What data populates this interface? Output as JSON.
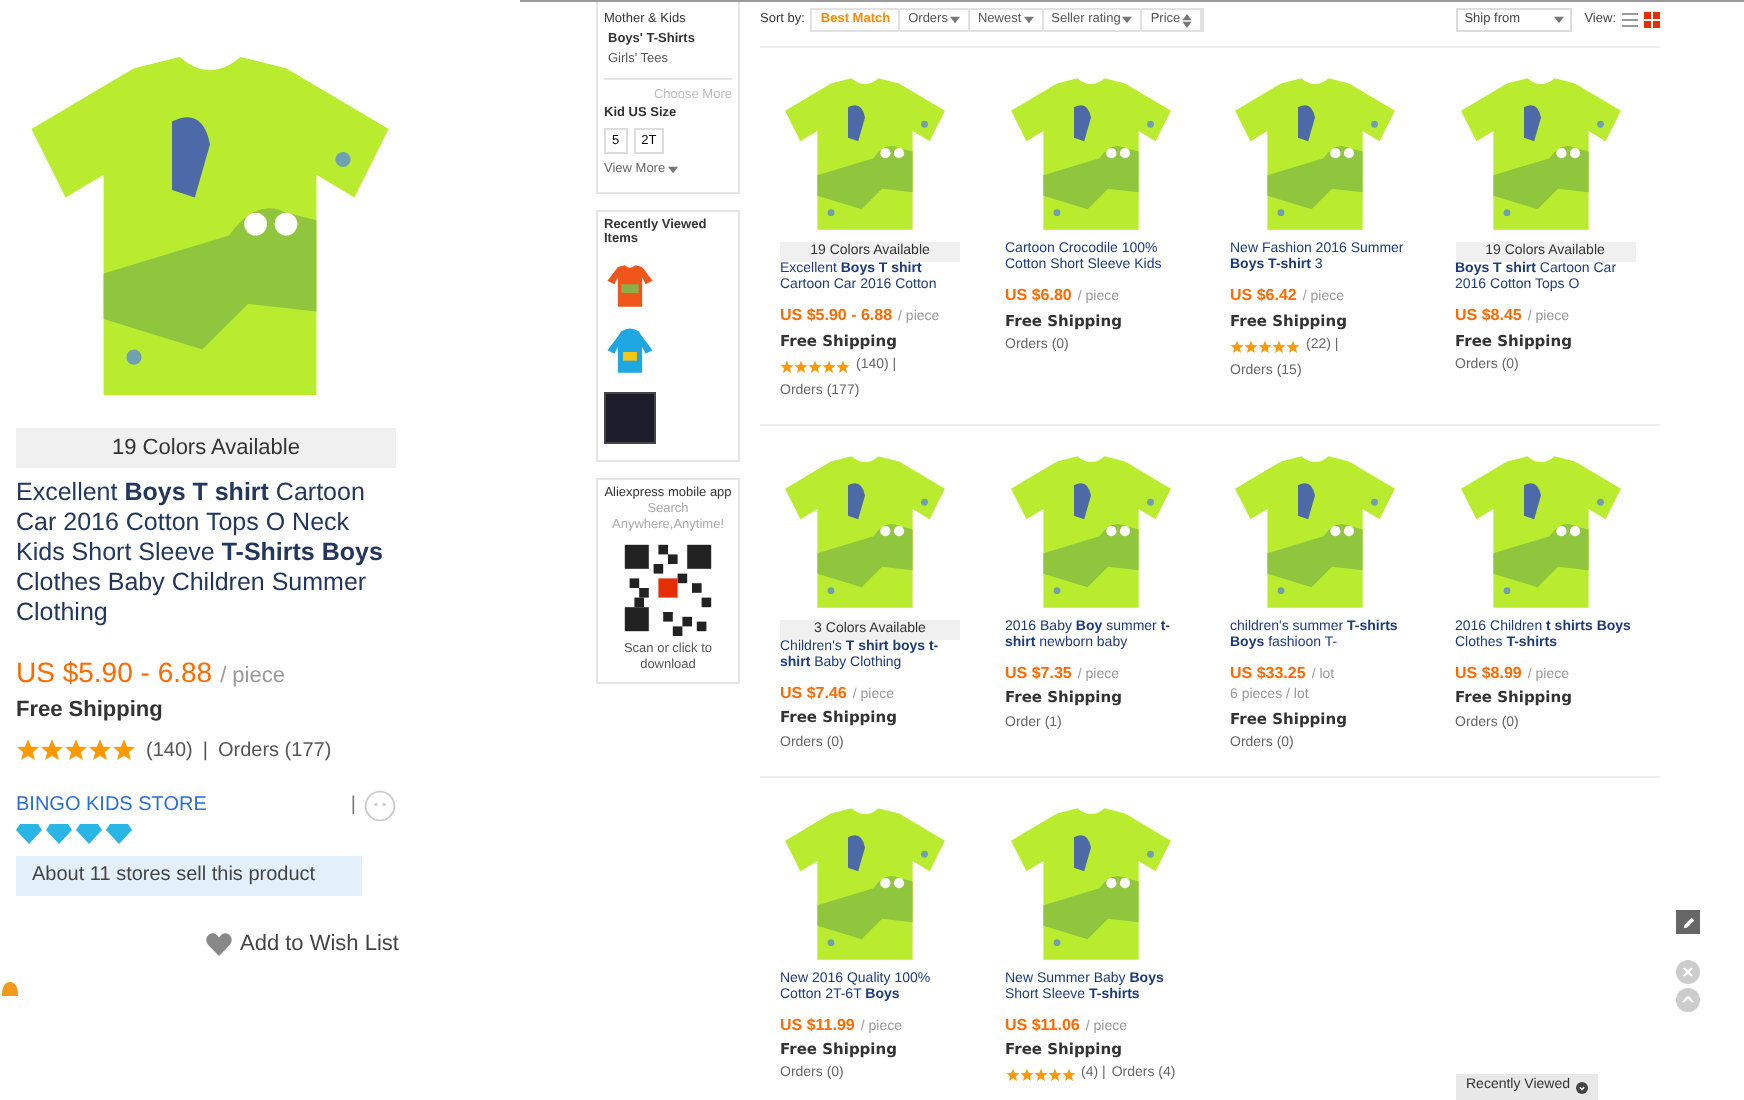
{
  "detail": {
    "badge": "19 Colors Available",
    "title": "Excellent **Boys T shirt** Cartoon Car 2016 Cotton Tops O Neck Kids Short Sleeve **T-Shirts Boys** Clothes Baby Children Summer Clothing",
    "price": "US $5.90 - 6.88",
    "unit": "/ piece",
    "shipping": "Free Shipping",
    "stars": 5,
    "reviews": "(140)",
    "separator": "|",
    "orders": "Orders (177)",
    "store": "BINGO KIDS STORE",
    "store_separator": "|",
    "stores_note": "About 11 stores sell this product",
    "wishlist": "Add to Wish List"
  },
  "sidebar": {
    "categories": [
      {
        "label": "Mother & Kids",
        "selected": false
      },
      {
        "label": "Boys' T-Shirts",
        "selected": true
      },
      {
        "label": "Girls' Tees",
        "selected": false
      }
    ],
    "choose_more": "Choose More",
    "size_title": "Kid US Size",
    "sizes": [
      {
        "label": "5",
        "selected": false
      },
      {
        "label": "2T",
        "selected": false
      }
    ],
    "view_more": "View More",
    "recently_viewed": {
      "title": "Recently Viewed Items",
      "items": [
        {
          "kind": "tee"
        },
        {
          "kind": "hoodie"
        },
        {
          "kind": "photo"
        }
      ]
    },
    "app": {
      "title": "Aliexpress mobile app",
      "subtitle": "Search Anywhere,Anytime!",
      "caption": "Scan or click to download"
    }
  },
  "toolbar": {
    "label": "Sort by:",
    "sorts": [
      {
        "label": "Best Match",
        "selected": true,
        "kind": "plain"
      },
      {
        "label": "Orders",
        "selected": false,
        "kind": "dropdown"
      },
      {
        "label": "Newest",
        "selected": false,
        "kind": "dropdown"
      },
      {
        "label": "Seller rating",
        "selected": false,
        "kind": "dropdown"
      },
      {
        "label": "Price",
        "selected": false,
        "kind": "range"
      }
    ],
    "ship_from": "Ship from",
    "view_label": "View:",
    "views": [
      {
        "kind": "list",
        "selected": false
      },
      {
        "kind": "grid",
        "selected": true
      }
    ]
  },
  "products": [
    {
      "badge": "19 Colors Available",
      "title": "Excellent **Boys T shirt** Cartoon Car 2016 Cotton",
      "price": "US $5.90 - 6.88",
      "unit": "/ piece",
      "shipping": "Free Shipping",
      "stars": 5,
      "reviews": "(140) |",
      "orders": "Orders (177)"
    },
    {
      "title": "Cartoon Crocodile 100% Cotton Short Sleeve Kids",
      "price": "US $6.80",
      "unit": "/ piece",
      "shipping": "Free Shipping",
      "orders": "Orders (0)"
    },
    {
      "title": "New Fashion 2016 Summer **Boys T-shirt** 3",
      "price": "US $6.42",
      "unit": "/ piece",
      "shipping": "Free Shipping",
      "stars": 5,
      "reviews": "(22) |",
      "orders": "Orders (15)"
    },
    {
      "badge": "19 Colors Available",
      "title": "**Boys T shirt** Cartoon Car 2016 Cotton Tops O",
      "price": "US $8.45",
      "unit": "/ piece",
      "shipping": "Free Shipping",
      "orders": "Orders (0)"
    },
    {
      "badge": "3 Colors Available",
      "title": "Children's **T shirt boys t-shirt** Baby Clothing",
      "price": "US $7.46",
      "unit": "/ piece",
      "shipping": "Free Shipping",
      "orders": "Orders (0)"
    },
    {
      "title": "2016 Baby **Boy** summer **t-shirt** newborn baby",
      "price": "US $7.35",
      "unit": "/ piece",
      "shipping": "Free Shipping",
      "orders": "Order (1)"
    },
    {
      "title": "children's summer **T-shirts Boys** fashioon T-",
      "price": "US $33.25",
      "unit": "/ lot",
      "lot": "6 pieces / lot",
      "shipping": "Free Shipping",
      "orders": "Orders (0)"
    },
    {
      "title": "2016 Children **t shirts Boys** Clothes **T-shirts**",
      "price": "US $8.99",
      "unit": "/ piece",
      "shipping": "Free Shipping",
      "orders": "Orders (0)"
    },
    {
      "title": "New 2016 Quality 100% Cotton 2T-6T **Boys**",
      "price": "US $11.99",
      "unit": "/ piece",
      "shipping": "Free Shipping",
      "orders": "Orders (0)"
    },
    {
      "title": "New Summer Baby **Boys** Short Sleeve **T-shirts**",
      "price": "US $11.06",
      "unit": "/ piece",
      "shipping": "Free Shipping",
      "stars": 5,
      "reviews": "(4) |",
      "orders": "Orders (4)"
    }
  ],
  "recently_viewed_tab": "Recently Viewed"
}
